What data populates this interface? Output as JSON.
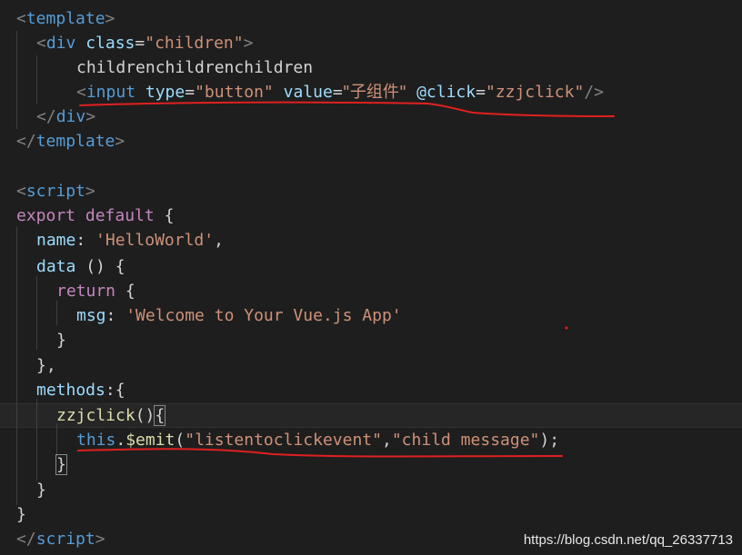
{
  "code": {
    "l1": {
      "open": "<",
      "tag": "template",
      "close": ">"
    },
    "l2": {
      "open": "<",
      "tag": "div",
      "attr": "class",
      "eq": "=",
      "val": "\"children\"",
      "close": ">"
    },
    "l3": {
      "text": "childrenchildrenchildren"
    },
    "l4": {
      "open": "<",
      "tag": "input",
      "attr1": "type",
      "eq1": "=",
      "val1": "\"button\"",
      "attr2": "value",
      "eq2": "=",
      "val2": "\"子组件\"",
      "attr3": "@click",
      "eq3": "=",
      "val3": "\"zzjclick\"",
      "close": "/>"
    },
    "l5": {
      "open": "</",
      "tag": "div",
      "close": ">"
    },
    "l6": {
      "open": "</",
      "tag": "template",
      "close": ">"
    },
    "l8": {
      "open": "<",
      "tag": "script",
      "close": ">"
    },
    "l9": {
      "kw1": "export",
      "kw2": "default",
      "brace": "{"
    },
    "l10": {
      "prop": "name",
      "colon": ":",
      "val": "'HelloWorld'",
      "comma": ","
    },
    "l11": {
      "prop": "data",
      "rest": " () {"
    },
    "l12": {
      "kw": "return",
      "brace": " {"
    },
    "l13": {
      "prop": "msg",
      "colon": ":",
      "val": "'Welcome to Your Vue.js App'"
    },
    "l14": {
      "text": "}"
    },
    "l15": {
      "text": "},"
    },
    "l16": {
      "prop": "methods",
      "rest": ":{"
    },
    "l17": {
      "fn": "zzjclick",
      "paren": "()",
      "brace": "{"
    },
    "l18": {
      "this": "this",
      "dot": ".",
      "fn": "$emit",
      "p1": "(",
      "s1": "\"listentoclickevent\"",
      "comma": ",",
      "s2": "\"child message\"",
      "p2": ");"
    },
    "l19": {
      "text": "}"
    },
    "l20": {
      "text": "}"
    },
    "l21": {
      "text": "}"
    },
    "l22": {
      "open": "</",
      "tag": "script",
      "close": ">"
    }
  },
  "watermark": "https://blog.csdn.net/qq_26337713",
  "colors": {
    "background": "#1e1e1e",
    "tag": "#569cd6",
    "attribute": "#9cdcfe",
    "string": "#ce9178",
    "keyword": "#c586c0",
    "function": "#dcdcaa",
    "annotation": "#e02020"
  }
}
